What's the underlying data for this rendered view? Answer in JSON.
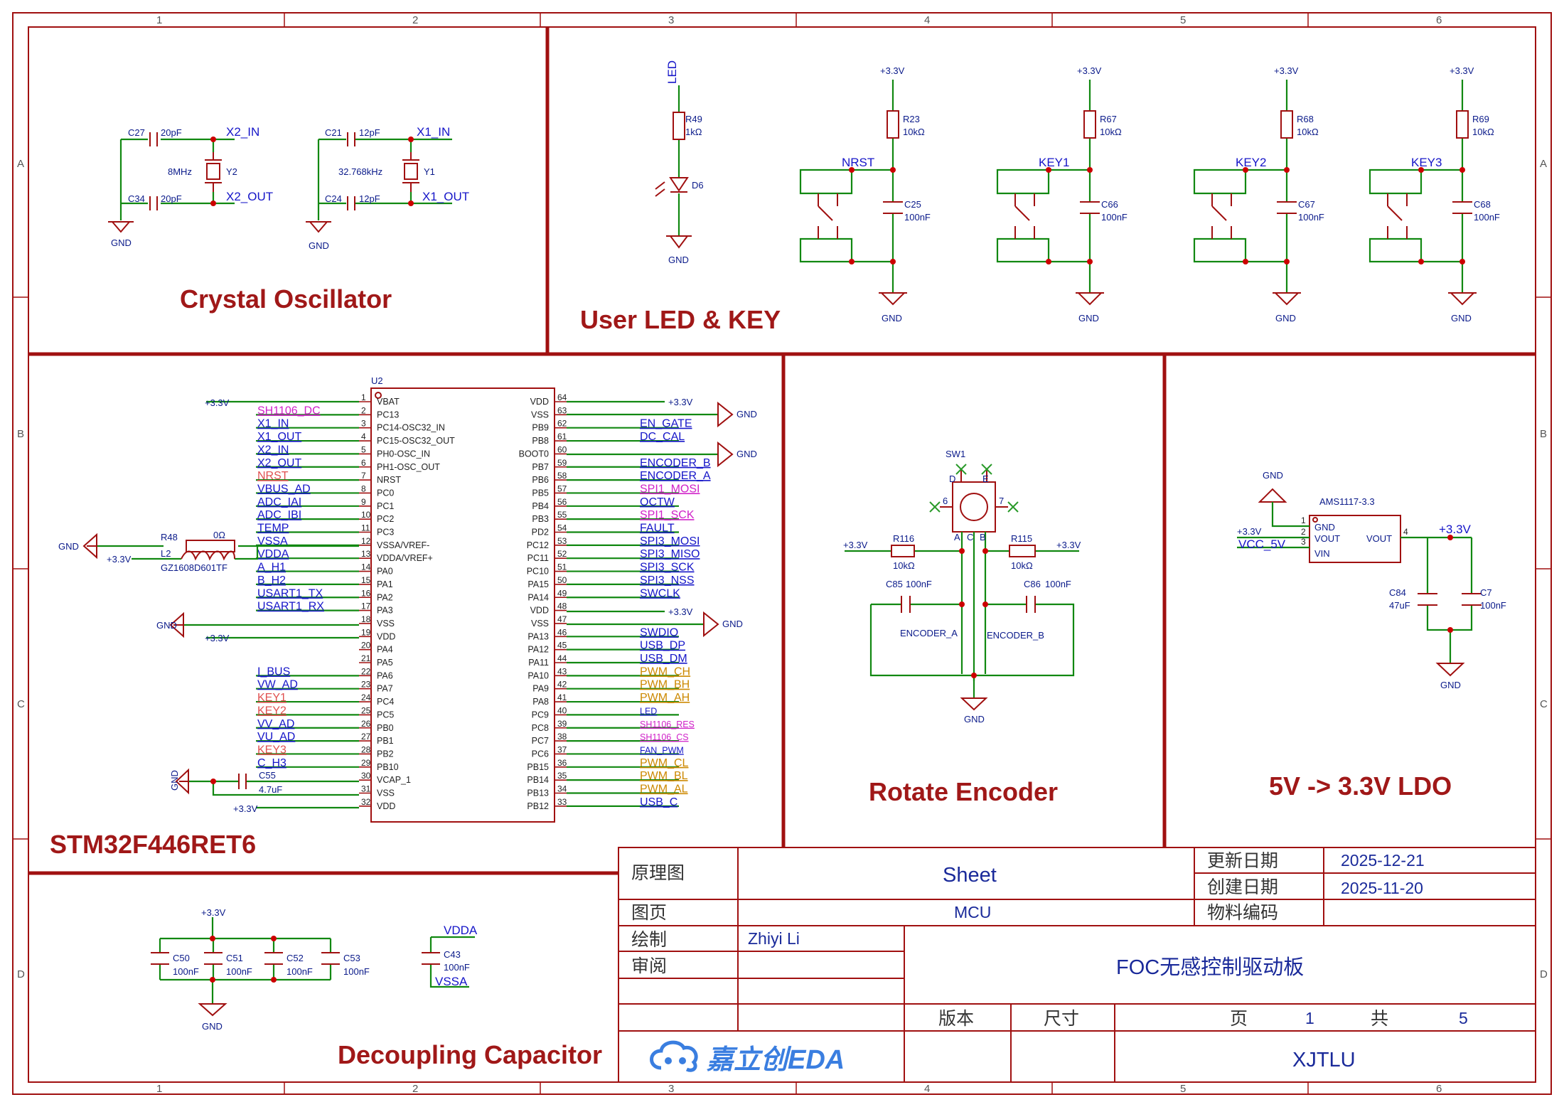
{
  "ruler": {
    "columns": [
      "1",
      "2",
      "3",
      "4",
      "5",
      "6"
    ],
    "rows": [
      "A",
      "B",
      "C",
      "D"
    ]
  },
  "titles": {
    "crystal": "Crystal Oscillator",
    "userled": "User LED & KEY",
    "mcu": "STM32F446RET6",
    "encoder": "Rotate Encoder",
    "ldo": "5V -> 3.3V LDO",
    "decoupling": "Decoupling Capacitor"
  },
  "power": {
    "v33": "+3.3V",
    "gnd": "GND",
    "vdda": "VDDA",
    "vssa": "VSSA",
    "vcc5": "VCC_5V"
  },
  "crystal": {
    "c27": "C27",
    "c27v": "20pF",
    "c34": "C34",
    "c34v": "20pF",
    "y2": "Y2",
    "y2f": "8MHz",
    "x2in": "X2_IN",
    "x2out": "X2_OUT",
    "c21": "C21",
    "c21v": "12pF",
    "c24": "C24",
    "c24v": "12pF",
    "y1": "Y1",
    "y1f": "32.768kHz",
    "x1in": "X1_IN",
    "x1out": "X1_OUT"
  },
  "led": {
    "net": "LED",
    "r": "R49",
    "rv": "1kΩ",
    "d": "D6"
  },
  "keys": [
    {
      "net": "NRST",
      "r": "R23",
      "rv": "10kΩ",
      "c": "C25",
      "cv": "100nF"
    },
    {
      "net": "KEY1",
      "r": "R67",
      "rv": "10kΩ",
      "c": "C66",
      "cv": "100nF"
    },
    {
      "net": "KEY2",
      "r": "R68",
      "rv": "10kΩ",
      "c": "C67",
      "cv": "100nF"
    },
    {
      "net": "KEY3",
      "r": "R69",
      "rv": "10kΩ",
      "c": "C68",
      "cv": "100nF"
    }
  ],
  "mcu": {
    "ref": "U2",
    "left": [
      {
        "n": "1",
        "p": "VBAT",
        "net": "+3.3V",
        "c": "pwr"
      },
      {
        "n": "2",
        "p": "PC13",
        "net": "SH1106_DC",
        "c": "mag"
      },
      {
        "n": "3",
        "p": "PC14-OSC32_IN",
        "net": "X1_IN",
        "c": "blue"
      },
      {
        "n": "4",
        "p": "PC15-OSC32_OUT",
        "net": "X1_OUT",
        "c": "blue"
      },
      {
        "n": "5",
        "p": "PH0-OSC_IN",
        "net": "X2_IN",
        "c": "blue"
      },
      {
        "n": "6",
        "p": "PH1-OSC_OUT",
        "net": "X2_OUT",
        "c": "blue"
      },
      {
        "n": "7",
        "p": "NRST",
        "net": "NRST",
        "c": "red"
      },
      {
        "n": "8",
        "p": "PC0",
        "net": "VBUS_AD",
        "c": "blue"
      },
      {
        "n": "9",
        "p": "PC1",
        "net": "ADC_IAI",
        "c": "blue"
      },
      {
        "n": "10",
        "p": "PC2",
        "net": "ADC_IBI",
        "c": "blue"
      },
      {
        "n": "11",
        "p": "PC3",
        "net": "TEMP",
        "c": "blue"
      },
      {
        "n": "12",
        "p": "VSSA/VREF-",
        "net": "VSSA",
        "c": "blue"
      },
      {
        "n": "13",
        "p": "VDDA/VREF+",
        "net": "VDDA",
        "c": "blue"
      },
      {
        "n": "14",
        "p": "PA0",
        "net": "A_H1",
        "c": "blue"
      },
      {
        "n": "15",
        "p": "PA1",
        "net": "B_H2",
        "c": "blue"
      },
      {
        "n": "16",
        "p": "PA2",
        "net": "USART1_TX",
        "c": "blue"
      },
      {
        "n": "17",
        "p": "PA3",
        "net": "USART1_RX",
        "c": "blue"
      },
      {
        "n": "18",
        "p": "VSS",
        "net": "",
        "c": "blue"
      },
      {
        "n": "19",
        "p": "VDD",
        "net": "",
        "c": "blue"
      },
      {
        "n": "20",
        "p": "PA4",
        "net": "",
        "c": "blue"
      },
      {
        "n": "21",
        "p": "PA5",
        "net": "",
        "c": "blue"
      },
      {
        "n": "22",
        "p": "PA6",
        "net": "I_BUS",
        "c": "blue"
      },
      {
        "n": "23",
        "p": "PA7",
        "net": "VW_AD",
        "c": "blue"
      },
      {
        "n": "24",
        "p": "PC4",
        "net": "KEY1",
        "c": "red"
      },
      {
        "n": "25",
        "p": "PC5",
        "net": "KEY2",
        "c": "red"
      },
      {
        "n": "26",
        "p": "PB0",
        "net": "VV_AD",
        "c": "blue"
      },
      {
        "n": "27",
        "p": "PB1",
        "net": "VU_AD",
        "c": "blue"
      },
      {
        "n": "28",
        "p": "PB2",
        "net": "KEY3",
        "c": "red"
      },
      {
        "n": "29",
        "p": "PB10",
        "net": "C_H3",
        "c": "blue"
      },
      {
        "n": "30",
        "p": "VCAP_1",
        "net": "",
        "c": "blue"
      },
      {
        "n": "31",
        "p": "VSS",
        "net": "",
        "c": "blue"
      },
      {
        "n": "32",
        "p": "VDD",
        "net": "",
        "c": "blue"
      }
    ],
    "right": [
      {
        "n": "64",
        "p": "VDD",
        "net": "",
        "c": "blue"
      },
      {
        "n": "63",
        "p": "VSS",
        "net": "",
        "c": "blue"
      },
      {
        "n": "62",
        "p": "PB9",
        "net": "EN_GATE",
        "c": "blue"
      },
      {
        "n": "61",
        "p": "PB8",
        "net": "DC_CAL",
        "c": "blue"
      },
      {
        "n": "60",
        "p": "BOOT0",
        "net": "",
        "c": "blue"
      },
      {
        "n": "59",
        "p": "PB7",
        "net": "ENCODER_B",
        "c": "blue"
      },
      {
        "n": "58",
        "p": "PB6",
        "net": "ENCODER_A",
        "c": "blue"
      },
      {
        "n": "57",
        "p": "PB5",
        "net": "SPI1_MOSI",
        "c": "mag"
      },
      {
        "n": "56",
        "p": "PB4",
        "net": "OCTW",
        "c": "blue"
      },
      {
        "n": "55",
        "p": "PB3",
        "net": "SPI1_SCK",
        "c": "mag"
      },
      {
        "n": "54",
        "p": "PD2",
        "net": "FAULT",
        "c": "blue"
      },
      {
        "n": "53",
        "p": "PC12",
        "net": "SPI3_MOSI",
        "c": "blue"
      },
      {
        "n": "52",
        "p": "PC11",
        "net": "SPI3_MISO",
        "c": "blue"
      },
      {
        "n": "51",
        "p": "PC10",
        "net": "SPI3_SCK",
        "c": "blue"
      },
      {
        "n": "50",
        "p": "PA15",
        "net": "SPI3_NSS",
        "c": "blue"
      },
      {
        "n": "49",
        "p": "PA14",
        "net": "SWCLK",
        "c": "blue"
      },
      {
        "n": "48",
        "p": "VDD",
        "net": "",
        "c": "blue"
      },
      {
        "n": "47",
        "p": "VSS",
        "net": "",
        "c": "blue"
      },
      {
        "n": "46",
        "p": "PA13",
        "net": "SWDIO",
        "c": "blue"
      },
      {
        "n": "45",
        "p": "PA12",
        "net": "USB_DP",
        "c": "blue"
      },
      {
        "n": "44",
        "p": "PA11",
        "net": "USB_DM",
        "c": "blue"
      },
      {
        "n": "43",
        "p": "PA10",
        "net": "PWM_CH",
        "c": "ora"
      },
      {
        "n": "42",
        "p": "PA9",
        "net": "PWM_BH",
        "c": "ora"
      },
      {
        "n": "41",
        "p": "PA8",
        "net": "PWM_AH",
        "c": "ora"
      },
      {
        "n": "40",
        "p": "PC9",
        "net": "LED",
        "c": "blues"
      },
      {
        "n": "39",
        "p": "PC8",
        "net": "SH1106_RES",
        "c": "mags"
      },
      {
        "n": "38",
        "p": "PC7",
        "net": "SH1106_CS",
        "c": "mags"
      },
      {
        "n": "37",
        "p": "PC6",
        "net": "FAN_PWM",
        "c": "blues"
      },
      {
        "n": "36",
        "p": "PB15",
        "net": "PWM_CL",
        "c": "ora"
      },
      {
        "n": "35",
        "p": "PB14",
        "net": "PWM_BL",
        "c": "ora"
      },
      {
        "n": "34",
        "p": "PB13",
        "net": "PWM_AL",
        "c": "ora"
      },
      {
        "n": "33",
        "p": "PB12",
        "net": "USB_C",
        "c": "blue"
      }
    ],
    "r48": "R48",
    "r48v": "0Ω",
    "l2": "L2",
    "l2v": "GZ1608D601TF",
    "c55": "C55",
    "c55v": "4.7uF"
  },
  "encoder": {
    "sw": "SW1",
    "r116": "R116",
    "r116v": "10kΩ",
    "r115": "R115",
    "r115v": "10kΩ",
    "c85": "C85",
    "c85v": "100nF",
    "c86": "C86",
    "c86v": "100nF",
    "enca": "ENCODER_A",
    "encb": "ENCODER_B",
    "pins": {
      "a": "A",
      "b": "B",
      "c": "C",
      "d": "D",
      "e": "E",
      "p6": "6",
      "p7": "7"
    }
  },
  "ldo": {
    "chip": "AMS1117-3.3",
    "gnd": "GND",
    "vout": "VOUT",
    "vin": "VIN",
    "vout2": "VOUT",
    "p1": "1",
    "p2": "2",
    "p3": "3",
    "p4": "4",
    "c84": "C84",
    "c84v": "47uF",
    "c7": "C7",
    "c7v": "100nF"
  },
  "decoupling": {
    "caps": [
      {
        "r": "C50",
        "v": "100nF"
      },
      {
        "r": "C51",
        "v": "100nF"
      },
      {
        "r": "C52",
        "v": "100nF"
      },
      {
        "r": "C53",
        "v": "100nF"
      }
    ],
    "c43": "C43",
    "c43v": "100nF"
  },
  "titleblock": {
    "schematic": "原理图",
    "sheet": "Sheet",
    "updated": "更新日期",
    "updated_v": "2025-12-21",
    "created": "创建日期",
    "created_v": "2025-11-20",
    "page": "图页",
    "page_v": "MCU",
    "part_no": "物料编码",
    "drawn": "绘制",
    "drawn_v": "Zhiyi Li",
    "review": "审阅",
    "project": "FOC无感控制驱动板",
    "version": "版本",
    "size": "尺寸",
    "pg": "页",
    "pg_v": "1",
    "total": "共",
    "total_v": "5",
    "brand": "嘉立创EDA",
    "org": "XJTLU"
  }
}
